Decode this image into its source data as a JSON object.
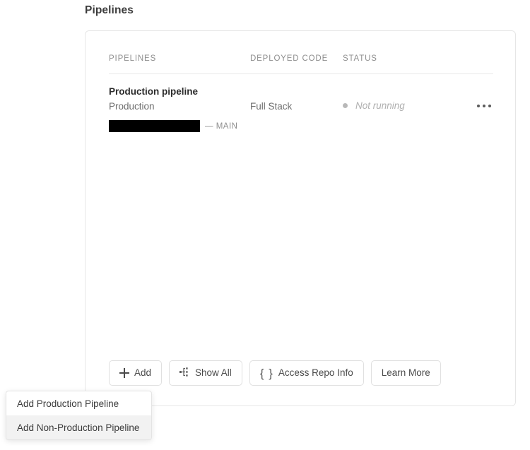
{
  "page": {
    "title": "Pipelines"
  },
  "table": {
    "headers": {
      "pipelines": "PIPELINES",
      "deployed_code": "DEPLOYED CODE",
      "status": "STATUS"
    },
    "rows": [
      {
        "name": "Production pipeline",
        "environment": "Production",
        "deployed_code": "Full Stack",
        "status": "Not running",
        "status_dot_color": "#b8b8b8",
        "repo_redacted": "",
        "branch": "— MAIN",
        "menu_icon": "kebab-icon"
      }
    ]
  },
  "toolbar": {
    "add_label": "Add",
    "add_icon": "plus-icon",
    "show_all_label": "Show All",
    "show_all_icon": "tree-branch-icon",
    "access_repo_label": "Access Repo Info",
    "access_repo_icon": "curly-braces-icon",
    "learn_more_label": "Learn More"
  },
  "dropdown": {
    "items": [
      {
        "label": "Add Production Pipeline",
        "hovered": false
      },
      {
        "label": "Add Non-Production Pipeline",
        "hovered": true
      }
    ]
  }
}
